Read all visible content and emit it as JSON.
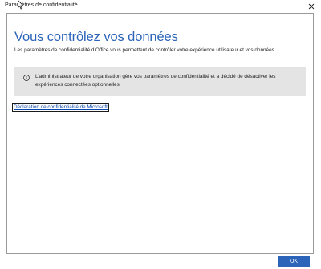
{
  "window": {
    "title": "Paramètres de confidentialité"
  },
  "main": {
    "heading": "Vous contrôlez vos données",
    "subtext": "Les paramètres de confidentialité d’Office vous permettent de contrôler votre expérience utilisateur et vos données.",
    "notice": {
      "icon": "info-icon",
      "text": "L’administrateur de votre organisation gère vos paramètres de confidentialité et a décidé de désactiver les expériences connectées optionnelles."
    },
    "privacy_link": "Déclaration de confidentialité de Microsoft"
  },
  "footer": {
    "ok_label": "OK"
  },
  "colors": {
    "accent": "#2b64b9",
    "notice_bg": "#e4e4e4",
    "link": "#0645ad"
  }
}
